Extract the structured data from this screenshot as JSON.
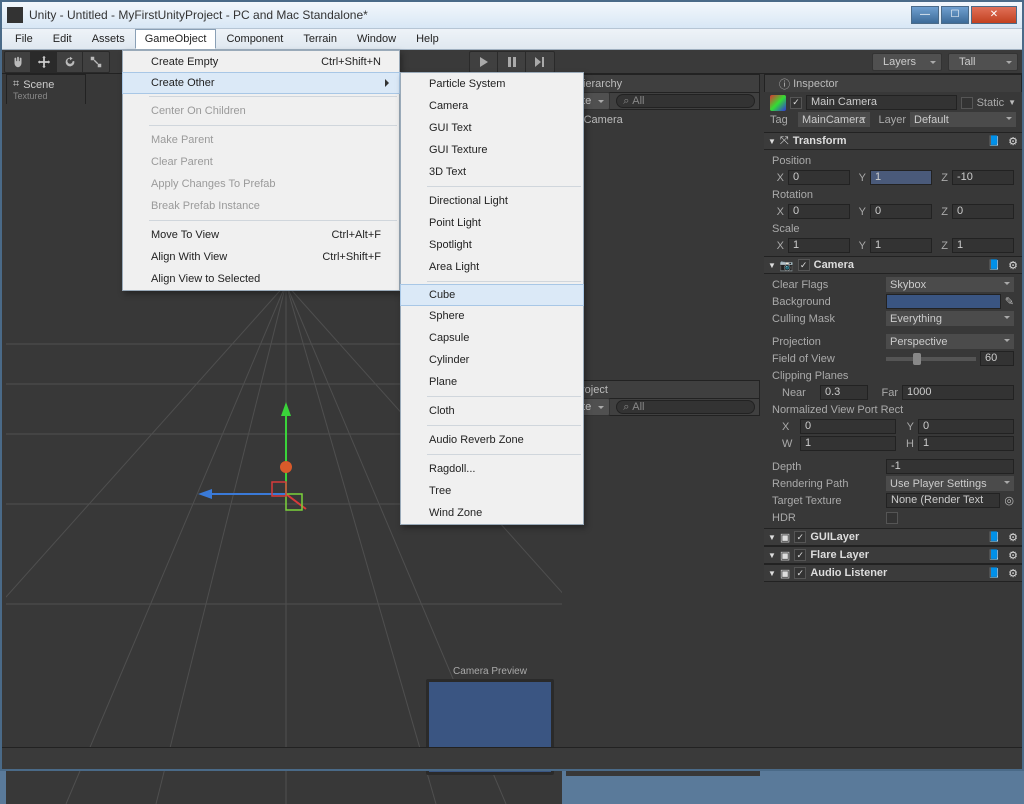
{
  "window": {
    "title": "Unity - Untitled - MyFirstUnityProject - PC and Mac Standalone*"
  },
  "menubar": [
    "File",
    "Edit",
    "Assets",
    "GameObject",
    "Component",
    "Terrain",
    "Window",
    "Help"
  ],
  "openMenuIndex": 3,
  "gameobject_menu": {
    "items": [
      {
        "label": "Create Empty",
        "shortcut": "Ctrl+Shift+N"
      },
      {
        "label": "Create Other",
        "submenu": true,
        "open": true
      },
      {
        "sep": true
      },
      {
        "label": "Center On Children",
        "disabled": true
      },
      {
        "sep": true
      },
      {
        "label": "Make Parent",
        "disabled": true
      },
      {
        "label": "Clear Parent",
        "disabled": true
      },
      {
        "label": "Apply Changes To Prefab",
        "disabled": true
      },
      {
        "label": "Break Prefab Instance",
        "disabled": true
      },
      {
        "sep": true
      },
      {
        "label": "Move To View",
        "shortcut": "Ctrl+Alt+F"
      },
      {
        "label": "Align With View",
        "shortcut": "Ctrl+Shift+F"
      },
      {
        "label": "Align View to Selected"
      }
    ]
  },
  "create_other_submenu": {
    "items": [
      "Particle System",
      "Camera",
      "GUI Text",
      "GUI Texture",
      "3D Text",
      "",
      "Directional Light",
      "Point Light",
      "Spotlight",
      "Area Light",
      "",
      "Cube",
      "Sphere",
      "Capsule",
      "Cylinder",
      "Plane",
      "",
      "Cloth",
      "",
      "Audio Reverb Zone",
      "",
      "Ragdoll...",
      "Tree",
      "Wind Zone"
    ],
    "highlight": "Cube"
  },
  "toolbar_right": {
    "layers": "Layers",
    "layout": "Tall"
  },
  "scene_tab": {
    "title": "Scene",
    "sub": "Textured"
  },
  "hierarchy": {
    "title": "Hierarchy",
    "create": "ate",
    "search_placeholder": "All",
    "items": [
      "in Camera"
    ]
  },
  "project": {
    "title": "roject",
    "create": "ate",
    "search_placeholder": "All"
  },
  "camera_preview_label": "Camera Preview",
  "inspector": {
    "title": "Inspector",
    "objectName": "Main Camera",
    "staticLabel": "Static",
    "tagLabel": "Tag",
    "tagValue": "MainCamera",
    "layerLabel": "Layer",
    "layerValue": "Default",
    "transform": {
      "header": "Transform",
      "pos": {
        "label": "Position",
        "x": "0",
        "y": "1",
        "z": "-10"
      },
      "rot": {
        "label": "Rotation",
        "x": "0",
        "y": "0",
        "z": "0"
      },
      "scale": {
        "label": "Scale",
        "x": "1",
        "y": "1",
        "z": "1"
      }
    },
    "camera": {
      "header": "Camera",
      "clearFlagsLabel": "Clear Flags",
      "clearFlags": "Skybox",
      "backgroundLabel": "Background",
      "backgroundColor": "#3a5582",
      "cullingLabel": "Culling Mask",
      "culling": "Everything",
      "projectionLabel": "Projection",
      "projection": "Perspective",
      "fovLabel": "Field of View",
      "fov": "60",
      "clipLabel": "Clipping Planes",
      "nearLabel": "Near",
      "near": "0.3",
      "farLabel": "Far",
      "far": "1000",
      "viewrectLabel": "Normalized View Port Rect",
      "viewrect": {
        "x": "0",
        "y": "0",
        "w": "1",
        "h": "1"
      },
      "depthLabel": "Depth",
      "depth": "-1",
      "renderPathLabel": "Rendering Path",
      "renderPath": "Use Player Settings",
      "targetTexLabel": "Target Texture",
      "targetTex": "None (Render Text",
      "hdrLabel": "HDR"
    },
    "components": [
      "GUILayer",
      "Flare Layer",
      "Audio Listener"
    ]
  }
}
